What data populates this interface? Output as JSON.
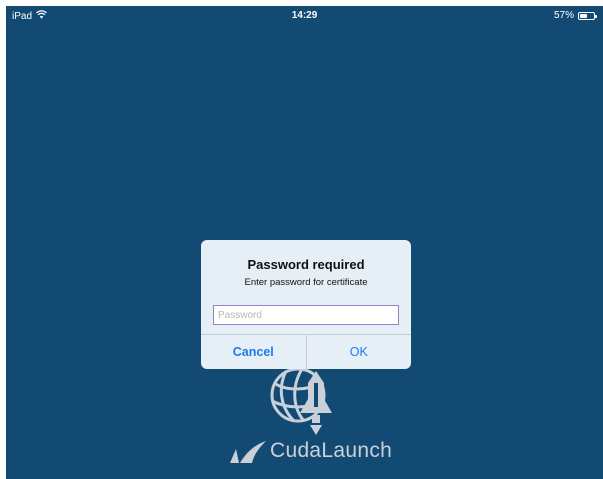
{
  "status_bar": {
    "device": "iPad",
    "time": "14:29",
    "battery_percent_label": "57%",
    "battery_level": 0.57,
    "wifi_icon": "wifi-icon",
    "battery_icon": "battery-icon"
  },
  "dialog": {
    "title": "Password required",
    "message": "Enter password for certificate",
    "password_placeholder": "Password",
    "password_value": "",
    "cancel_label": "Cancel",
    "ok_label": "OK"
  },
  "app": {
    "name": "CudaLaunch",
    "emblem_icon": "globe-rocket-icon",
    "mark_icon": "barracuda-mark-icon"
  },
  "colors": {
    "background": "#134a74",
    "dialog_background": "#e6eef6",
    "button_text": "#1a7bf0",
    "logo": "#c9d0d8"
  }
}
